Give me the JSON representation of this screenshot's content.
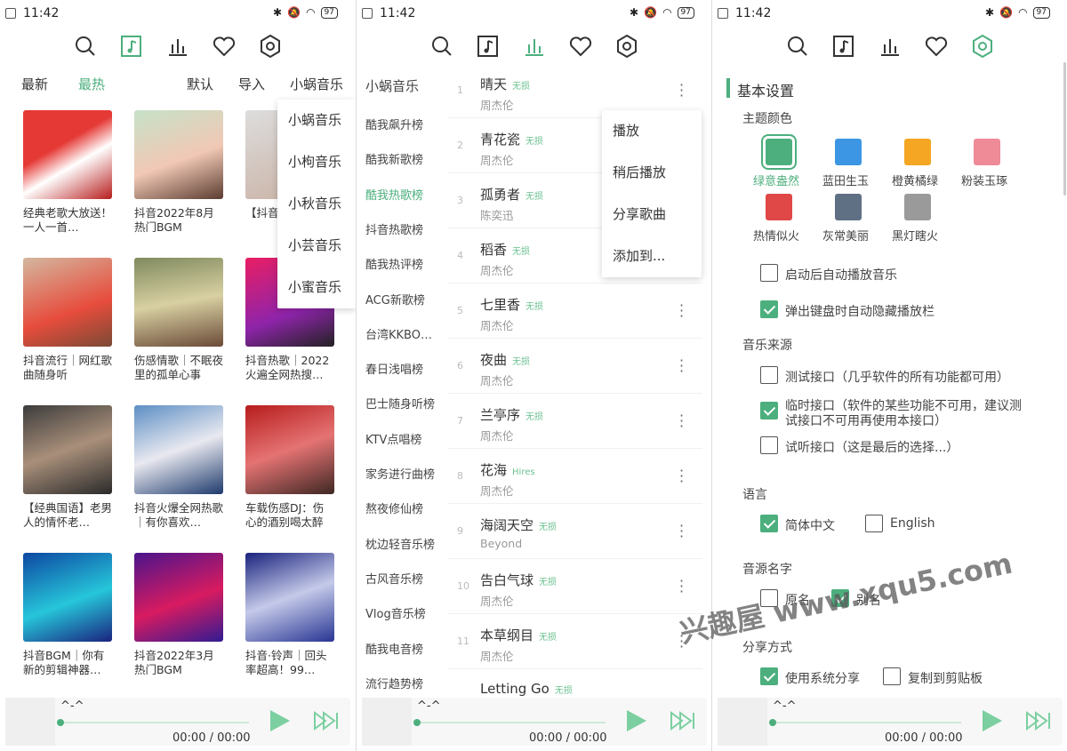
{
  "status": {
    "time": "11:42",
    "battery": "97"
  },
  "colors": {
    "accent": "#4caf7d",
    "text": "#333333"
  },
  "player": {
    "track": "^-^",
    "time": "00:00 / 00:00"
  },
  "panel1": {
    "tabs": {
      "newest": "最新",
      "hottest": "最热",
      "sort": "默认",
      "import": "导入",
      "source": "小蜗音乐"
    },
    "source_menu": [
      "小蜗音乐",
      "小枸音乐",
      "小秋音乐",
      "小芸音乐",
      "小蜜音乐"
    ],
    "cards": [
      {
        "caption": "经典老歌大放送！一人一首…"
      },
      {
        "caption": "抖音2022年8月热门BGM"
      },
      {
        "caption": "【抖音…歌，潮…"
      },
      {
        "caption": "抖音流行｜网红歌曲随身听"
      },
      {
        "caption": "伤感情歌｜不眠夜里的孤单心事"
      },
      {
        "caption": "抖音热歌｜2022火遍全网热搜…"
      },
      {
        "caption": "【经典国语】老男人的情怀老…"
      },
      {
        "caption": "抖音火爆全网热歌｜有你喜欢…"
      },
      {
        "caption": "车载伤感DJ：伤心的酒别喝太醉"
      },
      {
        "caption": "抖音BGM｜你有新的剪辑神器…"
      },
      {
        "caption": "抖音2022年3月热门BGM"
      },
      {
        "caption": "抖音·铃声｜回头率超高！99…"
      }
    ]
  },
  "panel2": {
    "boards": [
      "小蜗音乐",
      "酷我飙升榜",
      "酷我新歌榜",
      "酷我热歌榜",
      "抖音热歌榜",
      "酷我热评榜",
      "ACG新歌榜",
      "台湾KKBO…",
      "春日浅唱榜",
      "巴士随身听榜",
      "KTV点唱榜",
      "家务进行曲榜",
      "熬夜修仙榜",
      "枕边轻音乐榜",
      "古风音乐榜",
      "Vlog音乐榜",
      "酷我电音榜",
      "流行趋势榜"
    ],
    "songs": [
      {
        "num": "1",
        "name": "晴天",
        "tag": "无损",
        "artist": "周杰伦"
      },
      {
        "num": "2",
        "name": "青花瓷",
        "tag": "无损",
        "artist": "周杰伦"
      },
      {
        "num": "3",
        "name": "孤勇者",
        "tag": "无损",
        "artist": "陈奕迅"
      },
      {
        "num": "4",
        "name": "稻香",
        "tag": "无损",
        "artist": "周杰伦"
      },
      {
        "num": "5",
        "name": "七里香",
        "tag": "无损",
        "artist": "周杰伦"
      },
      {
        "num": "6",
        "name": "夜曲",
        "tag": "无损",
        "artist": "周杰伦"
      },
      {
        "num": "7",
        "name": "兰亭序",
        "tag": "无损",
        "artist": "周杰伦"
      },
      {
        "num": "8",
        "name": "花海",
        "tag": "Hires",
        "artist": "周杰伦"
      },
      {
        "num": "9",
        "name": "海阔天空",
        "tag": "无损",
        "artist": "Beyond"
      },
      {
        "num": "10",
        "name": "告白气球",
        "tag": "无损",
        "artist": "周杰伦"
      },
      {
        "num": "11",
        "name": "本草纲目",
        "tag": "无损",
        "artist": "周杰伦"
      },
      {
        "num": "",
        "name": "Letting Go",
        "tag": "无损",
        "artist": ""
      }
    ],
    "context_menu": [
      "播放",
      "稍后播放",
      "分享歌曲",
      "添加到..."
    ]
  },
  "panel3": {
    "title": "基本设置",
    "theme_label": "主题颜色",
    "themes": [
      {
        "name": "绿意盎然",
        "color": "#4caf7d"
      },
      {
        "name": "蓝田生玉",
        "color": "#3d96e3"
      },
      {
        "name": "橙黄橘绿",
        "color": "#f5a623"
      },
      {
        "name": "粉装玉琢",
        "color": "#ef8a97"
      },
      {
        "name": "热情似火",
        "color": "#e04848"
      },
      {
        "name": "灰常美丽",
        "color": "#5f7085"
      },
      {
        "name": "黑灯瞎火",
        "color": "#9a9a9a"
      }
    ],
    "autoplay": "启动后自动播放音乐",
    "hide_bar": "弹出键盘时自动隐藏播放栏",
    "source_label": "音乐来源",
    "source_test": "测试接口（几乎软件的所有功能都可用）",
    "source_temp_1": "临时接口（软件的某些功能不可用，建议测",
    "source_temp_2": "试接口不可用再使用本接口）",
    "source_trial": "试听接口（这是最后的选择...）",
    "lang_label": "语言",
    "lang_zh": "简体中文",
    "lang_en": "English",
    "name_label": "音源名字",
    "name_orig": "原名",
    "name_alias": "别名",
    "share_label": "分享方式",
    "share_sys": "使用系统分享",
    "share_copy": "复制到剪贴板"
  },
  "watermark": "兴趣屋 www.xqu5.com"
}
